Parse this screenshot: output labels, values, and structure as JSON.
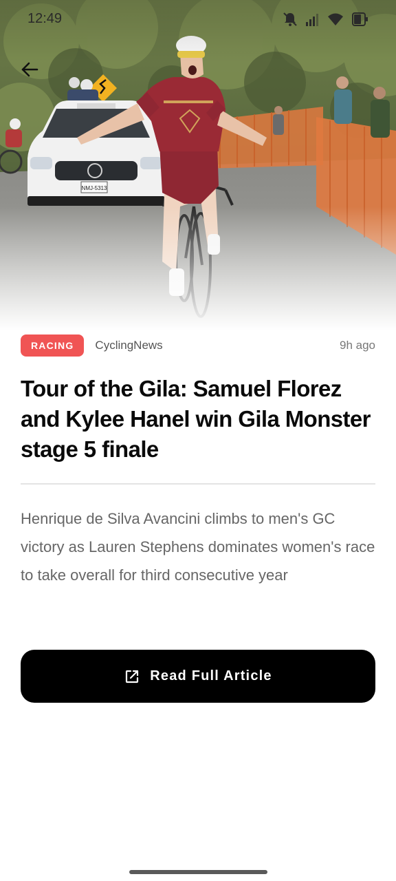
{
  "status_bar": {
    "time": "12:49",
    "icons": [
      "bell-off-icon",
      "signal-icon",
      "wifi-icon",
      "battery-icon"
    ]
  },
  "hero": {
    "image_subject": "cyclist-finish-photo",
    "back_icon": "arrow-left-icon",
    "car_plate": "NMJ-5313"
  },
  "article": {
    "category": "RACING",
    "source": "CyclingNews",
    "time_ago": "9h ago",
    "title": "Tour of the Gila: Samuel Florez and Kylee Hanel win Gila Monster stage 5 finale",
    "summary": "Henrique de Silva Avancini climbs to men's GC victory as Lauren Stephens dominates women's race to take overall for third consecutive year",
    "read_button_label": "Read Full Article",
    "read_button_icon": "open-external-icon"
  },
  "colors": {
    "badge": "#f05454",
    "button": "#000000",
    "title": "#0a0a0a",
    "summary": "#666666"
  }
}
